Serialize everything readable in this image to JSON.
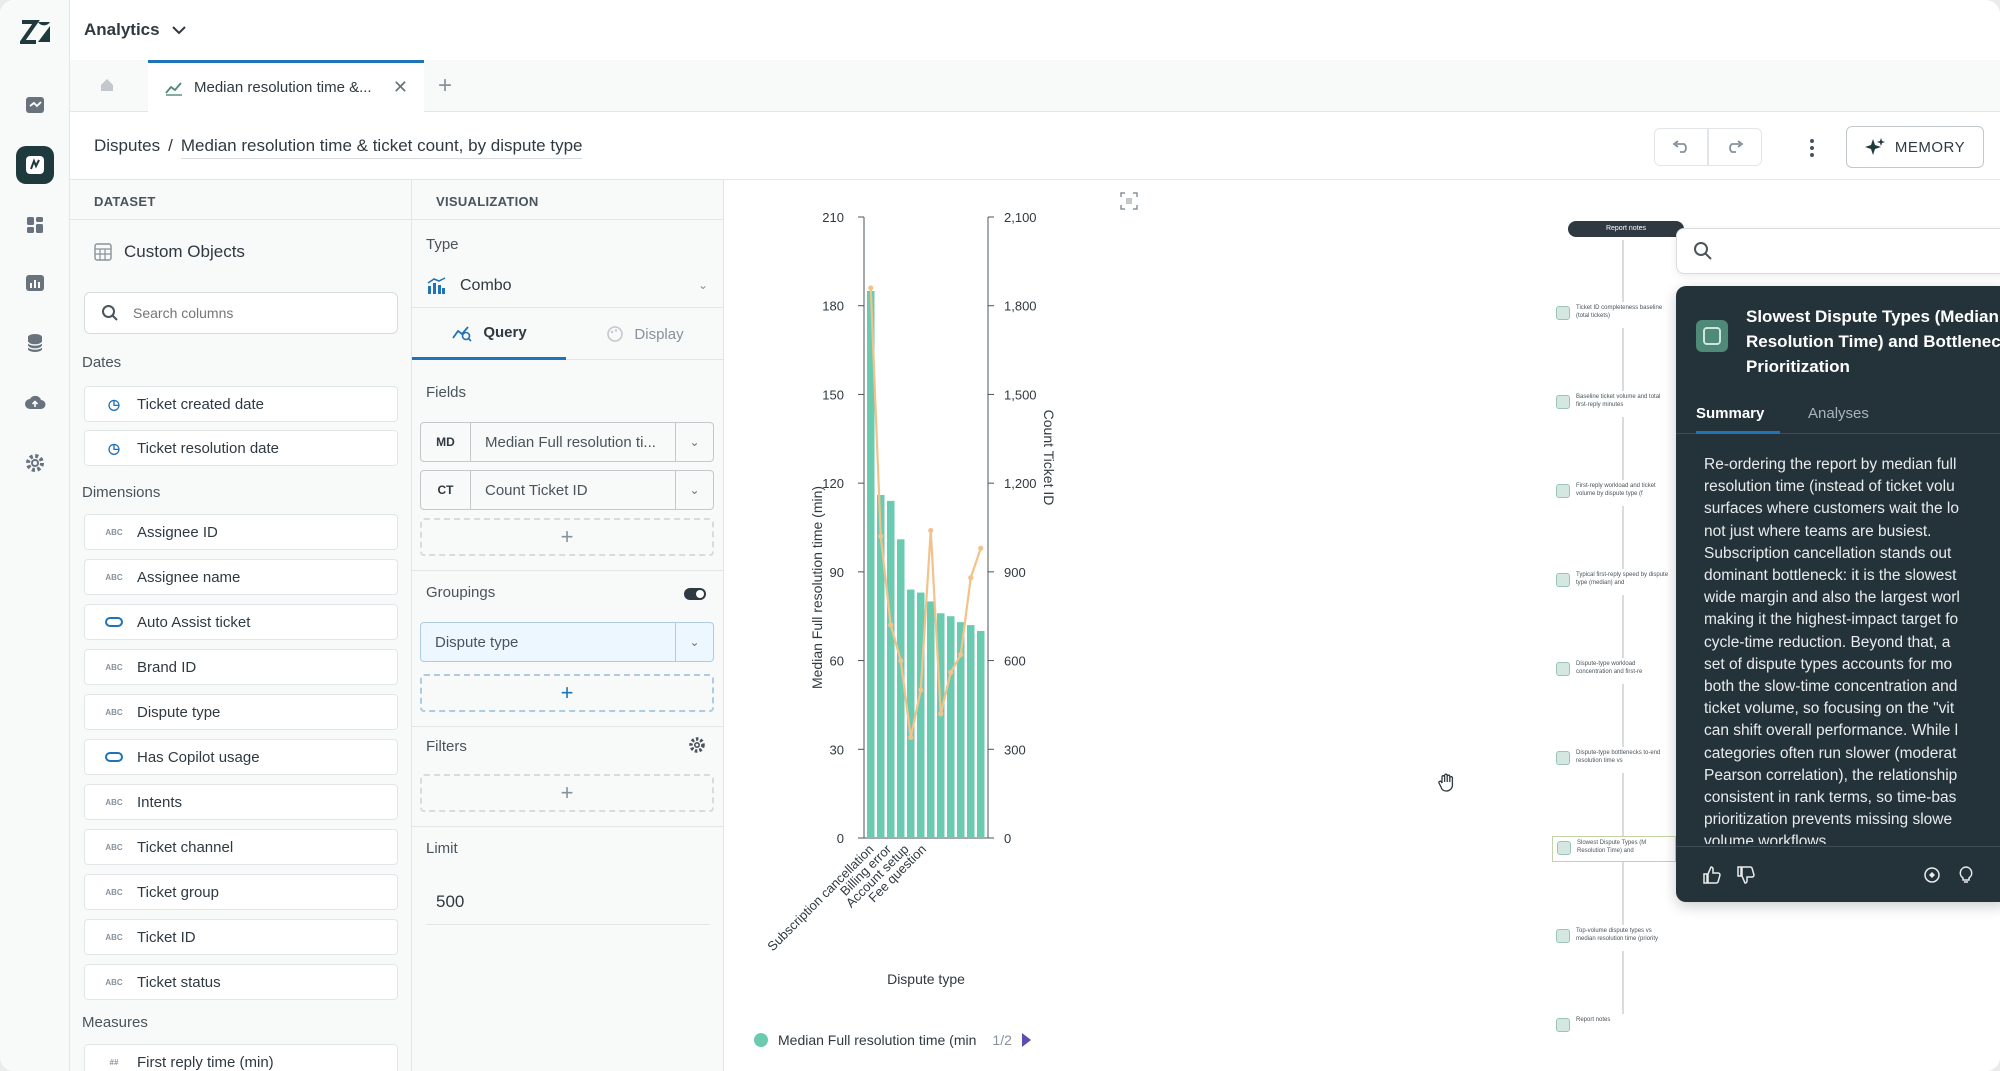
{
  "topbar": {
    "product": "Analytics"
  },
  "tabs": {
    "active_label": "Median resolution time &..."
  },
  "header": {
    "breadcrumb_root": "Disputes",
    "separator": "/",
    "report_title": "Median resolution time & ticket count, by dispute type",
    "memory_label": "MEMORY"
  },
  "dataset": {
    "heading": "DATASET",
    "name": "Custom Objects",
    "search_placeholder": "Search columns",
    "sections": {
      "dates": "Dates",
      "dimensions": "Dimensions",
      "measures": "Measures"
    },
    "dates": [
      "Ticket created date",
      "Ticket resolution date"
    ],
    "dimensions": [
      {
        "label": "Assignee ID",
        "kind": "text"
      },
      {
        "label": "Assignee name",
        "kind": "text"
      },
      {
        "label": "Auto Assist ticket",
        "kind": "toggle"
      },
      {
        "label": "Brand ID",
        "kind": "text"
      },
      {
        "label": "Dispute type",
        "kind": "text"
      },
      {
        "label": "Has Copilot usage",
        "kind": "toggle"
      },
      {
        "label": "Intents",
        "kind": "text"
      },
      {
        "label": "Ticket channel",
        "kind": "text"
      },
      {
        "label": "Ticket group",
        "kind": "text"
      },
      {
        "label": "Ticket ID",
        "kind": "text"
      },
      {
        "label": "Ticket status",
        "kind": "text"
      }
    ],
    "measures": [
      "First reply time (min)"
    ]
  },
  "visualization": {
    "heading": "VISUALIZATION",
    "type_label": "Type",
    "type_value": "Combo",
    "tab_query": "Query",
    "tab_display": "Display",
    "fields_label": "Fields",
    "fields": [
      {
        "tag": "MD",
        "name": "Median Full resolution ti..."
      },
      {
        "tag": "CT",
        "name": "Count Ticket ID"
      }
    ],
    "groupings_label": "Groupings",
    "grouping_value": "Dispute type",
    "filters_label": "Filters",
    "limit_label": "Limit",
    "limit_value": "500",
    "plus": "+"
  },
  "chart_data": {
    "type": "combo",
    "xlabel": "Dispute type",
    "ylabel_left": "Median Full resolution time (min)",
    "ylabel_right": "Count Ticket ID",
    "ylim_left": [
      0,
      210
    ],
    "ylim_right": [
      0,
      2100
    ],
    "yticks_left": [
      "0",
      "30",
      "60",
      "90",
      "120",
      "150",
      "180",
      "210"
    ],
    "yticks_right": [
      "0",
      "300",
      "600",
      "900",
      "1,200",
      "1,500",
      "1,800",
      "2,100"
    ],
    "category_labels_shown": [
      "Subscription cancellation",
      "Billing error",
      "Account setup",
      "Fee question"
    ],
    "bar_series": {
      "name": "Median Full resolution time (min",
      "values": [
        185,
        116,
        114,
        101,
        84,
        83,
        80,
        76,
        75,
        73,
        72,
        70
      ]
    },
    "line_series": {
      "values": [
        1860,
        1020,
        720,
        600,
        340,
        500,
        1040,
        420,
        560,
        620,
        880,
        980
      ]
    },
    "legend_pager": "1/2"
  },
  "canvas": {
    "flow_header": "Report notes",
    "nodes": [
      "Ticket ID completeness baseline (total tickets)",
      "Baseline ticket volume and total first-reply minutes",
      "First-reply workload and ticket volume by dispute type (f",
      "Typical first-reply speed by dispute type (median) and",
      "Dispute-type workload concentration and first-re",
      "Dispute-type bottlenecks to-end resolution time vs",
      "Slowest Dispute Types (M Resolution Time) and",
      "Top-volume dispute types vs median resolution time (priority",
      "Report notes"
    ]
  },
  "insight": {
    "title": "Slowest Dispute Types (Median\nResolution Time) and Bottleneck\nPrioritization",
    "tab_summary": "Summary",
    "tab_analyses": "Analyses",
    "body": "Re-ordering the report by median full\nresolution time (instead of ticket volu\nsurfaces where customers wait the lo\nnot just where teams are busiest.\nSubscription cancellation stands out\ndominant bottleneck: it is the slowest\nwide margin and also the largest worl\nmaking it the highest-impact target fo\ncycle-time reduction. Beyond that, a\nset of dispute types accounts for mo\nboth the slow-time concentration and\nticket volume, so focusing on the \"vit\ncan shift overall performance. While l\ncategories often run slower (moderat\nPearson correlation), the relationship\nconsistent in rank terms, so time-bas\nprioritization prevents missing slowe\nvolume workflows."
  }
}
